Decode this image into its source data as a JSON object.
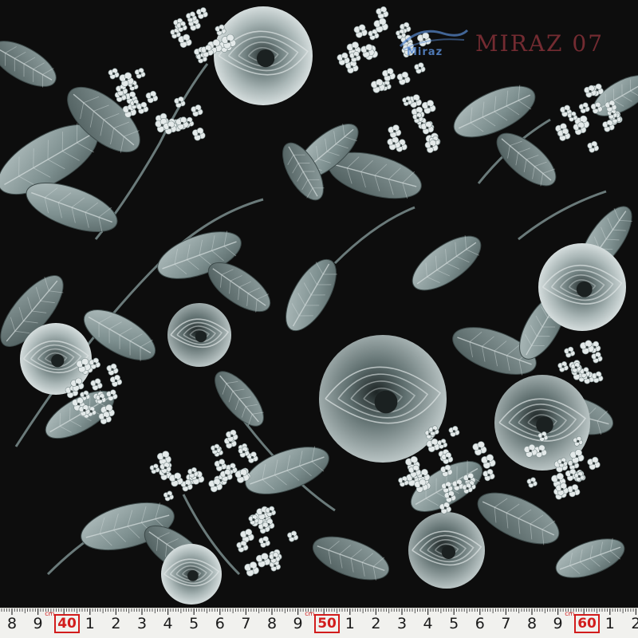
{
  "image": {
    "subject": "black floral fabric with grey roses, hydrangeas and leaves",
    "background_color": "#0d0d0d",
    "motif_colors": [
      "#c9d2d2",
      "#8fa0a0",
      "#5d6d6d",
      "#e8eeee"
    ]
  },
  "watermark": {
    "brand": "Miraz",
    "text": "MIRAZ 07"
  },
  "ruler": {
    "background": "#f1f1ee",
    "unit_label": "cm",
    "numbers": [
      "8",
      "9",
      "40",
      "1",
      "2",
      "3",
      "4",
      "5",
      "6",
      "7",
      "8",
      "9",
      "50",
      "1",
      "2",
      "3",
      "4",
      "5",
      "6",
      "7",
      "8",
      "9",
      "60",
      "1",
      "2"
    ],
    "highlighted": [
      "40",
      "50",
      "60"
    ],
    "accent_color": "#d21c1c"
  }
}
